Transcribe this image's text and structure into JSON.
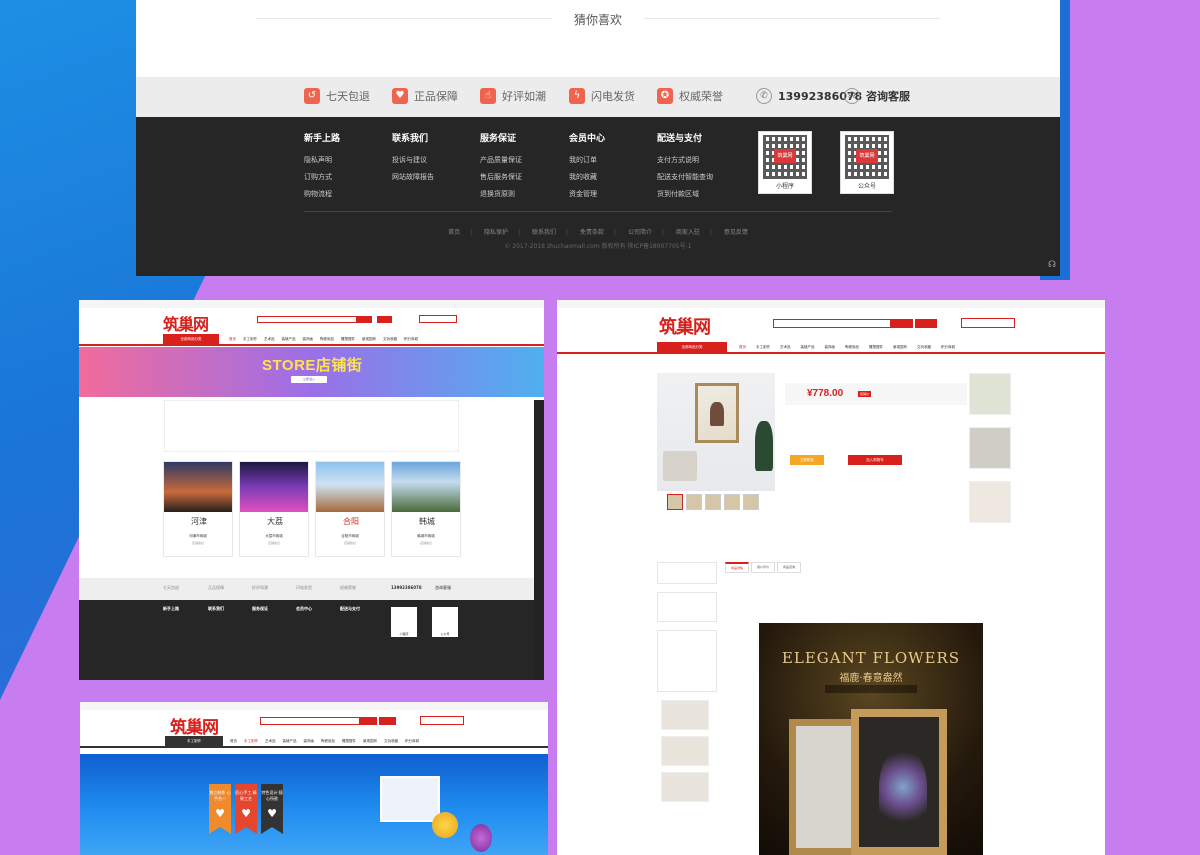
{
  "top_panel": {
    "guess_title": "猜你喜欢",
    "services": [
      {
        "icon": "return-icon",
        "label": "七天包退"
      },
      {
        "icon": "shield-icon",
        "label": "正品保障"
      },
      {
        "icon": "thumbs-up-icon",
        "label": "好评如潮"
      },
      {
        "icon": "lightning-icon",
        "label": "闪电发货"
      },
      {
        "icon": "award-icon",
        "label": "权威荣誉"
      }
    ],
    "phone": "13992386078",
    "support": "咨询客服",
    "footer_columns": [
      {
        "title": "新手上路",
        "items": [
          "隐私声明",
          "订购方式",
          "购物流程"
        ]
      },
      {
        "title": "联系我们",
        "items": [
          "投诉与建议",
          "网站故障报告"
        ]
      },
      {
        "title": "服务保证",
        "items": [
          "产品质量保证",
          "售后服务保证",
          "退换货原则"
        ]
      },
      {
        "title": "会员中心",
        "items": [
          "我的订单",
          "我的收藏",
          "资金管理"
        ]
      },
      {
        "title": "配送与支付",
        "items": [
          "支付方式说明",
          "配送支付智能查询",
          "货到付款区域"
        ]
      }
    ],
    "qr_codes": [
      {
        "badge": "筑巢网",
        "label": "小程序"
      },
      {
        "badge": "筑巢网",
        "label": "公众号"
      }
    ],
    "bottom_links": [
      "首页",
      "隐私保护",
      "联系我们",
      "免责条款",
      "公司简介",
      "商家入驻",
      "意见反馈"
    ],
    "copyright": "© 2017-2018 zhuchaomall.com 版权所有   陕ICP备18007705号-1"
  },
  "store_panel": {
    "logo": "筑巢网",
    "category_button": "全部商品分类",
    "nav": [
      "首页",
      "手工制作",
      "艺术品",
      "装裱产品",
      "装饰画",
      "陶瓷用品",
      "雕塑摆件",
      "景观园林",
      "文玩收藏",
      "积分商城"
    ],
    "banner_text": "STORE店铺街",
    "banner_button": "立即进入",
    "cities": [
      {
        "logo": "河津",
        "name": "河津市商城",
        "meta": "店铺信息"
      },
      {
        "logo": "大荔",
        "name": "大荔市商城",
        "meta": "店铺信息"
      },
      {
        "logo": "合阳",
        "name": "合阳市商城",
        "meta": "店铺信息"
      },
      {
        "logo": "韩城",
        "name": "韩城市商城",
        "meta": "店铺信息"
      }
    ],
    "services": [
      "七天包退",
      "正品保障",
      "好评如潮",
      "闪电发货",
      "权威荣誉"
    ],
    "phone": "13992386078",
    "support": "咨询客服",
    "footer_titles": [
      "新手上路",
      "联系我们",
      "服务保证",
      "会员中心",
      "配送与支付"
    ],
    "qr_labels": [
      "小程序",
      "公众号"
    ]
  },
  "detail_panel": {
    "logo": "筑巢网",
    "category_button": "全部商品分类",
    "nav": [
      "首页",
      "手工制作",
      "艺术品",
      "装裱产品",
      "装饰画",
      "陶瓷用品",
      "雕塑摆件",
      "景观园林",
      "文玩收藏",
      "积分商城"
    ],
    "price": "¥778.00",
    "price_tag": "促销价",
    "buy_now": "立即购买",
    "add_to_cart": "加入购物车",
    "tabs": [
      "商品详情",
      "用户评价",
      "商品咨询"
    ],
    "poster_title": "ELEGANT FLOWERS",
    "poster_subtitle": "福鹿·春意盎然"
  },
  "promo_panel": {
    "logo": "筑巢网",
    "category_button": "手工制作",
    "nav": [
      "首页",
      "手工制作",
      "艺术品",
      "装裱产品",
      "装饰画",
      "陶瓷用品",
      "雕塑摆件",
      "景观园林",
      "文玩收藏",
      "积分商城"
    ],
    "tags": [
      {
        "text": "独立制作 心手合一",
        "color": "#f08a2c"
      },
      {
        "text": "匠心手工 精致工艺",
        "color": "#e5462e"
      },
      {
        "text": "特色设计 随心所欲",
        "color": "#333333"
      }
    ]
  }
}
